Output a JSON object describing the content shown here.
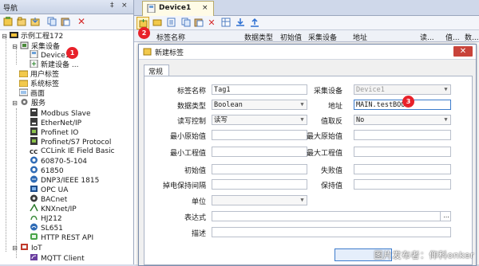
{
  "nav": {
    "title": "导航",
    "pin": "‡",
    "close": "×",
    "tree": [
      {
        "label": "示例工程172",
        "icon": "project-icon"
      },
      {
        "label": "采集设备",
        "icon": "device-group-icon"
      },
      {
        "label": "Device1",
        "icon": "device-icon"
      },
      {
        "label": "新建设备 ...",
        "icon": "new-device-icon"
      },
      {
        "label": "用户标签",
        "icon": "folder-icon"
      },
      {
        "label": "系统标签",
        "icon": "folder-icon"
      },
      {
        "label": "画面",
        "icon": "screen-icon"
      },
      {
        "label": "服务",
        "icon": "service-group-icon"
      },
      {
        "label": "Modbus Slave",
        "icon": "modbus-icon"
      },
      {
        "label": "EtherNet/IP",
        "icon": "ethernet-icon"
      },
      {
        "label": "Profinet IO",
        "icon": "profinet-icon"
      },
      {
        "label": "Profinet/S7 Protocol",
        "icon": "profinet-icon"
      },
      {
        "label": "CCLink IE Field Basic",
        "icon": "cclink-icon"
      },
      {
        "label": "60870-5-104",
        "icon": "iec-icon"
      },
      {
        "label": "61850",
        "icon": "iec-icon"
      },
      {
        "label": "DNP3/IEEE 1815",
        "icon": "dnp3-icon"
      },
      {
        "label": "OPC UA",
        "icon": "opcua-icon"
      },
      {
        "label": "BACnet",
        "icon": "bacnet-icon"
      },
      {
        "label": "KNXnet/IP",
        "icon": "knx-icon"
      },
      {
        "label": "HJ212",
        "icon": "hj212-icon"
      },
      {
        "label": "SL651",
        "icon": "sl651-icon"
      },
      {
        "label": "HTTP REST API",
        "icon": "http-icon"
      },
      {
        "label": "IoT",
        "icon": "iot-icon"
      },
      {
        "label": "MQTT Client",
        "icon": "mqtt-icon"
      }
    ]
  },
  "tab": {
    "label": "Device1",
    "close": "×"
  },
  "grid": {
    "columns": [
      "标签名称",
      "数据类型",
      "初始值",
      "采集设备",
      "地址",
      "读...",
      "值...",
      "数..."
    ]
  },
  "badges": {
    "b1": "1",
    "b2": "2",
    "b3": "3"
  },
  "dialog": {
    "title": "新建标签",
    "close": "✕",
    "tab": "常规",
    "fields": {
      "tag_name": {
        "label": "标签名称",
        "value": "Tag1"
      },
      "device": {
        "label": "采集设备",
        "value": "Device1"
      },
      "data_type": {
        "label": "数据类型",
        "value": "Boolean"
      },
      "address": {
        "label": "地址",
        "value": "MAIN.testBOOL"
      },
      "rw": {
        "label": "读写控制",
        "value": "读写"
      },
      "invert": {
        "label": "值取反",
        "value": "No"
      },
      "min_raw": {
        "label": "最小原始值",
        "value": ""
      },
      "max_raw": {
        "label": "最大原始值",
        "value": ""
      },
      "min_eng": {
        "label": "最小工程值",
        "value": ""
      },
      "max_eng": {
        "label": "最大工程值",
        "value": ""
      },
      "init": {
        "label": "初始值",
        "value": ""
      },
      "fail": {
        "label": "失败值",
        "value": ""
      },
      "retain_interval": {
        "label": "掉电保持间隔",
        "value": ""
      },
      "retain": {
        "label": "保持值",
        "value": ""
      },
      "unit": {
        "label": "单位",
        "value": ""
      },
      "expression": {
        "label": "表达式",
        "value": "",
        "browse": "..."
      },
      "desc": {
        "label": "描述",
        "value": ""
      }
    }
  },
  "watermark": "图片发布者：仰科onker"
}
